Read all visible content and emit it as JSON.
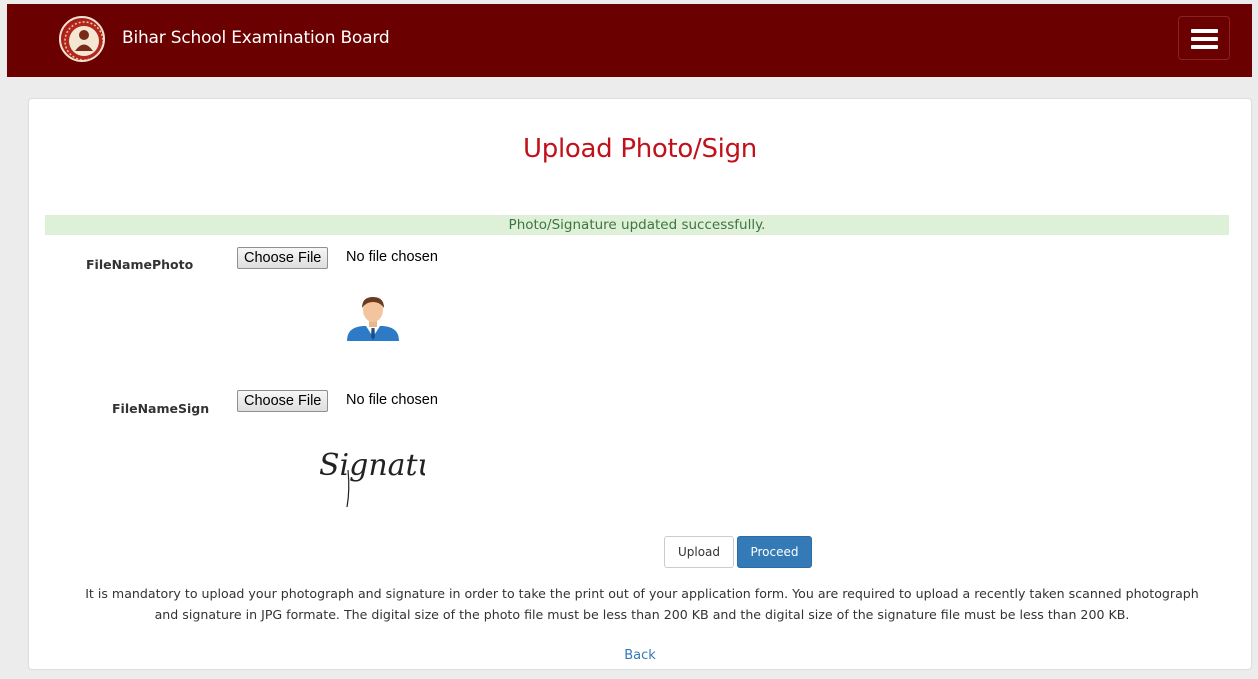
{
  "header": {
    "brand": "Bihar School Examination Board",
    "menu_icon": "hamburger-menu-icon",
    "logo_icon": "bseb-emblem-icon",
    "background_color": "#6b0000"
  },
  "page": {
    "title": "Upload Photo/Sign",
    "title_color": "#c1121c",
    "alert": "Photo/Signature updated successfully."
  },
  "photo": {
    "label": "FileNamePhoto",
    "button": "Choose File",
    "status": "No file chosen",
    "preview_icon": "person-avatar-icon"
  },
  "sign": {
    "label": "FileNameSign",
    "button": "Choose File",
    "status": "No file chosen",
    "preview_text": "Signature"
  },
  "actions": {
    "upload_label": "Upload",
    "proceed_label": "Proceed"
  },
  "note": {
    "line1": "It is mandatory to upload your photograph and signature in order to take the print out of your application form. You are required to upload a recently taken scanned photograph",
    "line2": "and signature in JPG formate. The digital size of the photo file must be less than 200 KB and the digital size of the signature file must be less than 200 KB."
  },
  "footer": {
    "back_label": "Back"
  }
}
